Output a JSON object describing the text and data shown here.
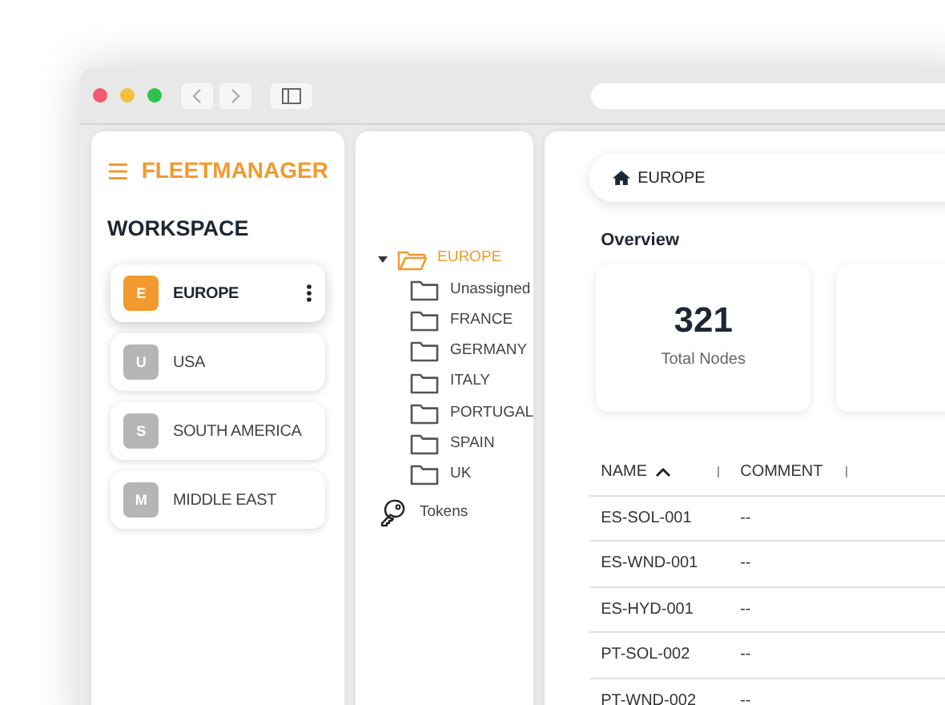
{
  "app": {
    "title": "FLEETMANAGER"
  },
  "workspace": {
    "heading": "WORKSPACE",
    "items": [
      {
        "initial": "E",
        "name": "EUROPE",
        "selected": true
      },
      {
        "initial": "U",
        "name": "USA",
        "selected": false
      },
      {
        "initial": "S",
        "name": "SOUTH AMERICA",
        "selected": false
      },
      {
        "initial": "M",
        "name": "MIDDLE EAST",
        "selected": false
      }
    ]
  },
  "tree": {
    "root": {
      "label": "EUROPE",
      "expanded": true,
      "children": [
        {
          "label": "Unassigned"
        },
        {
          "label": "FRANCE"
        },
        {
          "label": "GERMANY"
        },
        {
          "label": "ITALY"
        },
        {
          "label": "PORTUGAL"
        },
        {
          "label": "SPAIN"
        },
        {
          "label": "UK"
        }
      ]
    },
    "tokens": {
      "label": "Tokens"
    }
  },
  "main": {
    "breadcrumb": "EUROPE",
    "overview_heading": "Overview",
    "stats": [
      {
        "value": "321",
        "label": "Total Nodes"
      }
    ],
    "table": {
      "columns": [
        {
          "label": "NAME",
          "sorted": true
        },
        {
          "label": "COMMENT",
          "sorted": false
        }
      ],
      "rows": [
        {
          "name": "ES-SOL-001",
          "comment": "--"
        },
        {
          "name": "ES-WND-001",
          "comment": "--"
        },
        {
          "name": "ES-HYD-001",
          "comment": "--"
        },
        {
          "name": "PT-SOL-002",
          "comment": "--"
        },
        {
          "name": "PT-WND-002",
          "comment": "--"
        }
      ]
    }
  }
}
